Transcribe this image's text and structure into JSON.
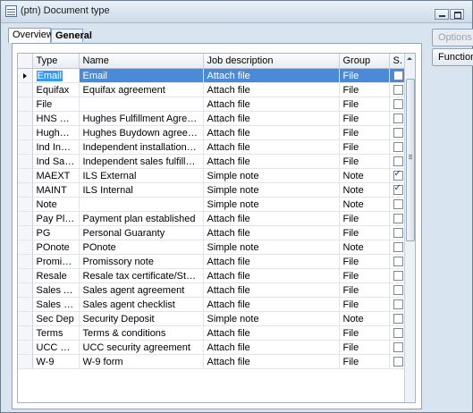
{
  "window": {
    "title": "(ptn) Document type"
  },
  "tabs": [
    {
      "label": "Overview"
    },
    {
      "label": "General"
    }
  ],
  "side_buttons": {
    "options": "Options",
    "functions": "Functions"
  },
  "grid": {
    "columns": {
      "type": "Type",
      "name": "Name",
      "job": "Job description",
      "group": "Group",
      "s": "S."
    },
    "rows": [
      {
        "type": "Email",
        "name": "Email",
        "job": "Attach file",
        "group": "File",
        "checked": false,
        "selected": true
      },
      {
        "type": "Equifax",
        "name": "Equifax agreement",
        "job": "Attach file",
        "group": "File",
        "checked": false
      },
      {
        "type": "File",
        "name": "",
        "job": "Attach file",
        "group": "File",
        "checked": false
      },
      {
        "type": "HNS FUL",
        "name": "Hughes Fulfillment Agreement",
        "job": "Attach file",
        "group": "File",
        "checked": false
      },
      {
        "type": "Hughes B...",
        "name": "Hughes Buydown agreement",
        "job": "Attach file",
        "group": "File",
        "checked": false
      },
      {
        "type": "Ind Instal",
        "name": "Independent installation agreem...",
        "job": "Attach file",
        "group": "File",
        "checked": false
      },
      {
        "type": "Ind Sales",
        "name": "Independent sales fulfillment ag...",
        "job": "Attach file",
        "group": "File",
        "checked": false
      },
      {
        "type": "MAEXT",
        "name": "ILS External",
        "job": "Simple note",
        "group": "Note",
        "checked": true
      },
      {
        "type": "MAINT",
        "name": "ILS Internal",
        "job": "Simple note",
        "group": "Note",
        "checked": true
      },
      {
        "type": "Note",
        "name": "",
        "job": "Simple note",
        "group": "Note",
        "checked": false
      },
      {
        "type": "Pay Plan",
        "name": "Payment plan established",
        "job": "Attach file",
        "group": "File",
        "checked": false
      },
      {
        "type": "PG",
        "name": "Personal Guaranty",
        "job": "Attach file",
        "group": "File",
        "checked": false
      },
      {
        "type": "POnote",
        "name": "POnote",
        "job": "Simple note",
        "group": "Note",
        "checked": false
      },
      {
        "type": "Promissory",
        "name": "Promissory note",
        "job": "Attach file",
        "group": "File",
        "checked": false
      },
      {
        "type": "Resale",
        "name": "Resale tax certificate/State of AR",
        "job": "Attach file",
        "group": "File",
        "checked": false
      },
      {
        "type": "Sales Agre",
        "name": "Sales agent agreement",
        "job": "Attach file",
        "group": "File",
        "checked": false
      },
      {
        "type": "Sales Chec",
        "name": "Sales agent checklist",
        "job": "Attach file",
        "group": "File",
        "checked": false
      },
      {
        "type": "Sec Dep",
        "name": "Security Deposit",
        "job": "Simple note",
        "group": "Note",
        "checked": false
      },
      {
        "type": "Terms",
        "name": "Terms & conditions",
        "job": "Attach file",
        "group": "File",
        "checked": false
      },
      {
        "type": "UCC secur",
        "name": "UCC security agreement",
        "job": "Attach file",
        "group": "File",
        "checked": false
      },
      {
        "type": "W-9",
        "name": "W-9 form",
        "job": "Attach file",
        "group": "File",
        "checked": false
      }
    ]
  }
}
